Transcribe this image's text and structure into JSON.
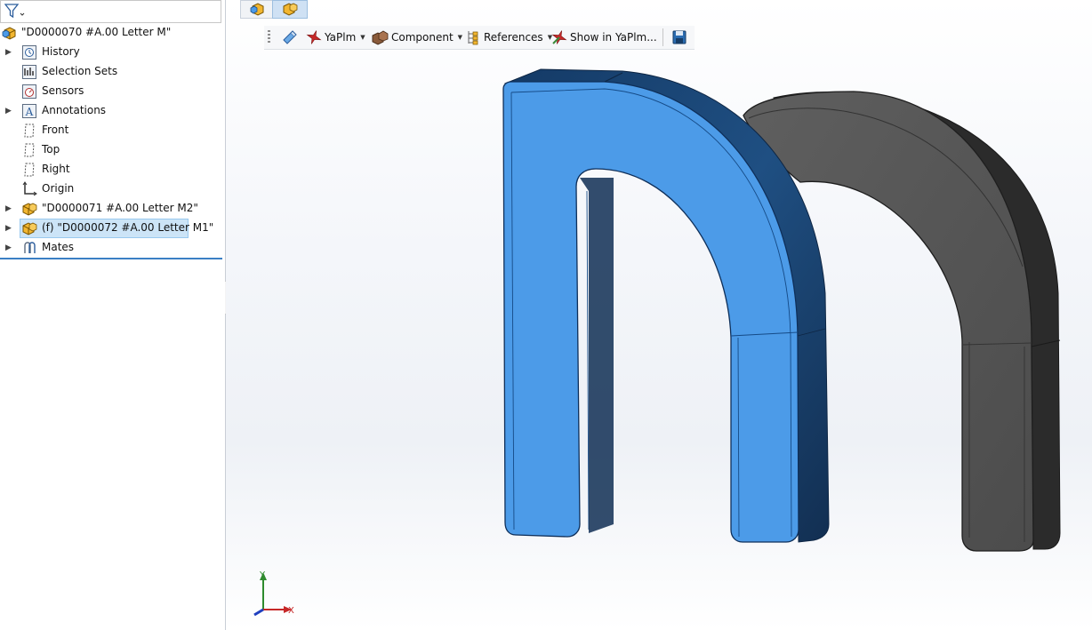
{
  "tree": {
    "filter_icon": "filter-icon",
    "root": {
      "label": "\"D0000070 #A.00 Letter M\"",
      "icon": "assembly-icon"
    },
    "items": [
      {
        "label": "History",
        "icon": "history-icon",
        "expandable": true
      },
      {
        "label": "Selection Sets",
        "icon": "selection-sets-icon",
        "expandable": false
      },
      {
        "label": "Sensors",
        "icon": "sensors-icon",
        "expandable": false
      },
      {
        "label": "Annotations",
        "icon": "annotations-icon",
        "expandable": true
      },
      {
        "label": "Front",
        "icon": "plane-icon",
        "expandable": false
      },
      {
        "label": "Top",
        "icon": "plane-icon",
        "expandable": false
      },
      {
        "label": "Right",
        "icon": "plane-icon",
        "expandable": false
      },
      {
        "label": "Origin",
        "icon": "origin-icon",
        "expandable": false
      },
      {
        "label": "\"D0000071 #A.00 Letter M2\"",
        "icon": "part-icon",
        "expandable": true
      },
      {
        "label": "(f) \"D0000072 #A.00 Letter M1\"",
        "icon": "part-icon",
        "expandable": true,
        "selected": true
      },
      {
        "label": "Mates",
        "icon": "mates-icon",
        "expandable": true
      }
    ]
  },
  "toolbar": {
    "yapim_label": "YaPlm",
    "component_label": "Component",
    "references_label": "References",
    "show_label": "Show in YaPlm..."
  },
  "triad": {
    "y_label": "Y",
    "x_label": "X"
  },
  "colors": {
    "selected_part": "#4c9be8",
    "other_part": "#555555",
    "selection_highlight": "#cce4f7",
    "tree_separator": "#3b7fc4"
  }
}
